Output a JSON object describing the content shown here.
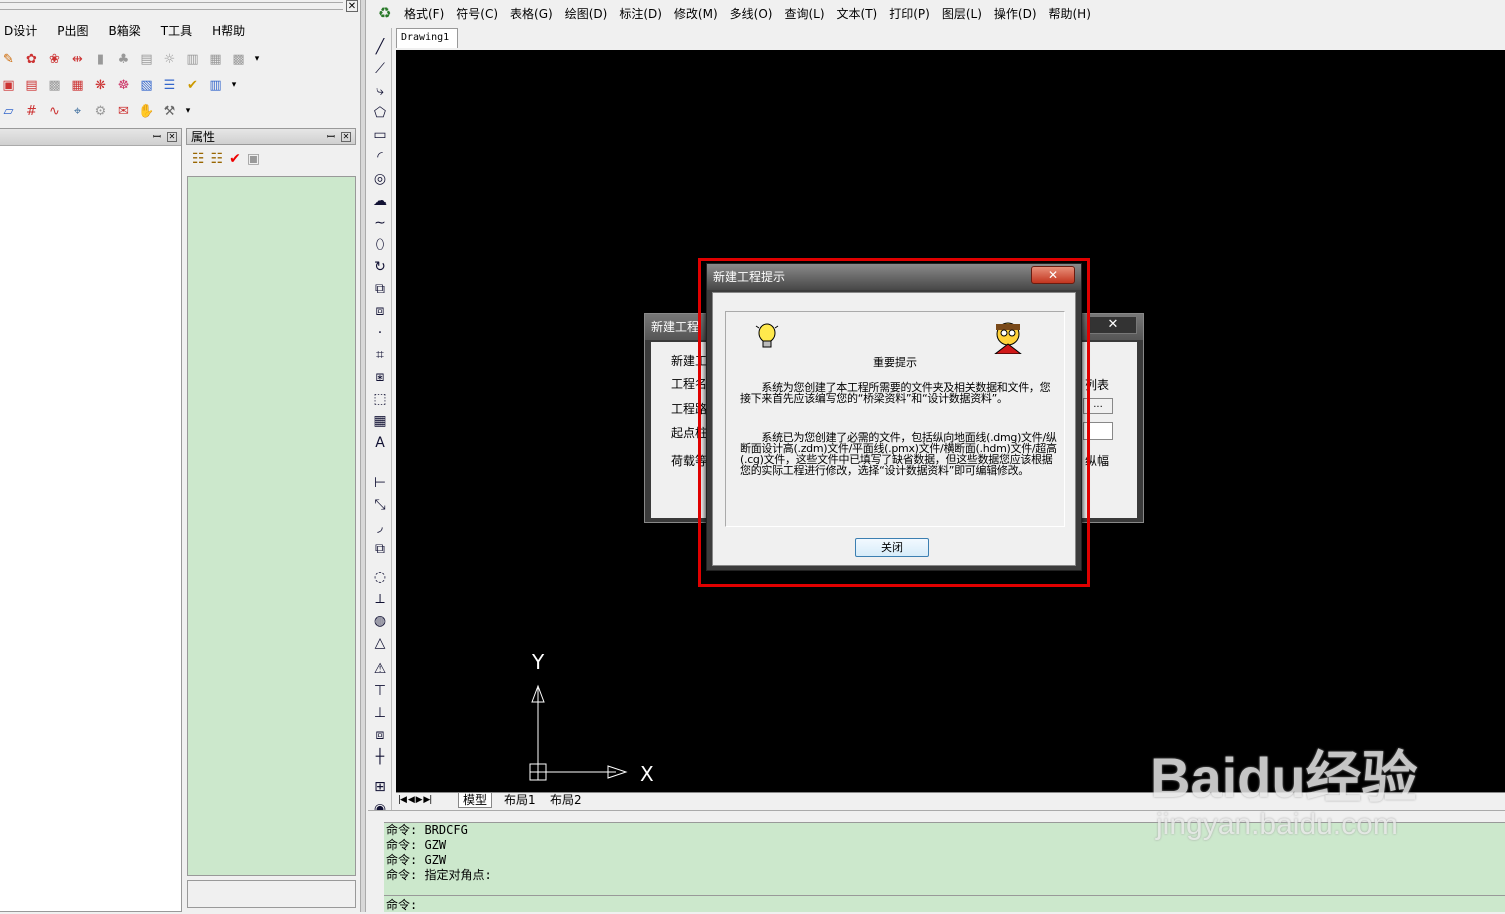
{
  "left_menu": {
    "items": [
      "D设计",
      "P出图",
      "B箱梁",
      "T工具",
      "H帮助"
    ],
    "close": "✕"
  },
  "toolbar_rows": [
    [
      "✎",
      "✿",
      "❀",
      "⇹",
      "▮",
      "♣",
      "▤",
      "☼",
      "▥",
      "▦",
      "▩",
      "▾"
    ],
    [
      "▣",
      "▤",
      "▩",
      "▦",
      "❋",
      "☸",
      "▧",
      "☰",
      "✔",
      "▥",
      "▾"
    ],
    [
      "▱",
      "#",
      "∿",
      "⌖",
      "⚙",
      "✉",
      "✋",
      "⚒",
      "▾"
    ]
  ],
  "props_panel": {
    "title": "属性",
    "pin": "ꟷ",
    "close": "✕",
    "icons": [
      "☷",
      "☷",
      "✔",
      "▣"
    ]
  },
  "right_menu": {
    "items": [
      "格式(F)",
      "符号(C)",
      "表格(G)",
      "绘图(D)",
      "标注(D)",
      "修改(M)",
      "多线(O)",
      "查询(L)",
      "文本(T)",
      "打印(P)",
      "图层(L)",
      "操作(D)",
      "帮助(H)"
    ]
  },
  "vertical_tools": [
    "╱",
    "⟋",
    "⤷",
    "⬠",
    "▭",
    "◜",
    "◎",
    "☁",
    "∼",
    "⬯",
    "↻",
    "⧉",
    "⧈",
    "·",
    "⌗",
    "⧆",
    "⬚",
    "▦",
    "A",
    "⊢",
    "⤡",
    "◞",
    "⧉",
    "◌",
    "⟂",
    "◍",
    "△",
    "⚠",
    "⊤",
    "⊥",
    "⧈",
    "┼",
    "⊞",
    "◉"
  ],
  "drawing_tab": "Drawing1",
  "layout_tabs": {
    "nav": "|◀ ◀ ▶ ▶|",
    "tabs": [
      "模型",
      "布局1",
      "布局2"
    ]
  },
  "command_lines": [
    "命令: BRDCFG",
    "命令: GZW",
    "命令: GZW",
    "命令: 指定对角点:"
  ],
  "command_prompt": "命令:",
  "back_dialog": {
    "title": "新建工程",
    "labels": [
      "新建工",
      "工程名",
      "工程路",
      "起点桩",
      "荷载等"
    ],
    "right_labels": [
      "列表",
      "...",
      "纵幅"
    ],
    "close": "✕"
  },
  "dialog": {
    "title": "新建工程提示",
    "close": "✕",
    "heading": "重要提示",
    "para1": "　　系统为您创建了本工程所需要的文件夹及相关数据和文件，您接下来首先应该编写您的“桥梁资料”和“设计数据资料”。",
    "para2": "　　系统已为您创建了必需的文件，包括纵向地面线(.dmg)文件/纵断面设计高(.zdm)文件/平面线(.pmx)文件/横断面(.hdm)文件/超高(.cg)文件，这些文件中已填写了缺省数据，但这些数据您应该根据您的实际工程进行修改，选择“设计数据资料”即可编辑修改。",
    "button": "关闭"
  },
  "ucs": {
    "x": "X",
    "y": "Y"
  },
  "watermark": {
    "brand": "Baidu经验",
    "url": "jingyan.baidu.com"
  }
}
